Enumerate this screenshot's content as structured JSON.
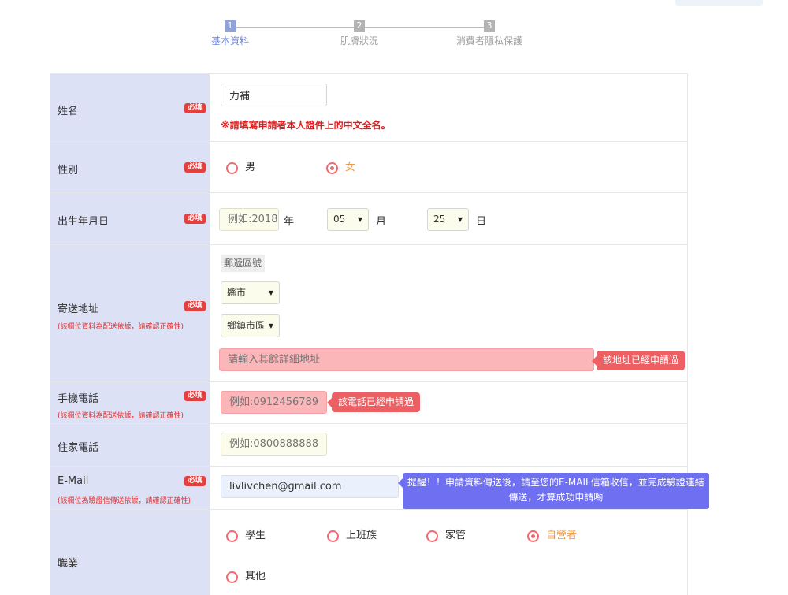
{
  "steps": [
    {
      "num": "1",
      "label": "基本資料",
      "active": true
    },
    {
      "num": "2",
      "label": "肌膚狀況",
      "active": false
    },
    {
      "num": "3",
      "label": "消費者隱私保護",
      "active": false
    }
  ],
  "required_badge": "必填",
  "fields": {
    "name": {
      "label": "姓名",
      "value": "力補",
      "error": "※請填寫申請者本人證件上的中文全名。"
    },
    "gender": {
      "label": "性別",
      "options": [
        "男",
        "女"
      ],
      "selected": "女"
    },
    "birthday": {
      "label": "出生年月日",
      "year_placeholder": "例如:2018",
      "year_unit": "年",
      "month_value": "05",
      "month_unit": "月",
      "day_value": "25",
      "day_unit": "日"
    },
    "address": {
      "label": "寄送地址",
      "note": "(該欄位資料為配送依據，請確認正確性)",
      "postal_label": "郵遞區號",
      "city_value": "縣市",
      "district_value": "鄉鎮市區",
      "detail_placeholder": "請輸入其餘詳細地址",
      "tip": "該地址已經申請過"
    },
    "mobile": {
      "label": "手機電話",
      "note": "(該欄位資料為配送依據，請確認正確性)",
      "placeholder": "例如:0912456789",
      "tip": "該電話已經申請過"
    },
    "home_phone": {
      "label": "住家電話",
      "placeholder": "例如:0800888888"
    },
    "email": {
      "label": "E-Mail",
      "note": "(該欄位為驗證信傳送依據，請確認正確性)",
      "value": "livlivchen@gmail.com",
      "tip_line1": "提醒！！申請資料傳送後，請至您的E-MAIL信箱收信，並完成驗證連結",
      "tip_line2": "傳送，才算成功申請喲"
    },
    "occupation": {
      "label": "職業",
      "options": [
        "學生",
        "上班族",
        "家管",
        "自營者",
        "其他"
      ],
      "selected": "自營者"
    }
  },
  "colors": {
    "label_bg": "#dde1f5",
    "required": "#e33f3f",
    "error_input": "#fbb6ba",
    "tip": "#ec5f63",
    "reminder": "#6f70f1",
    "active_step": "#6f84d2",
    "radio_checked_text": "#f09a3f"
  }
}
